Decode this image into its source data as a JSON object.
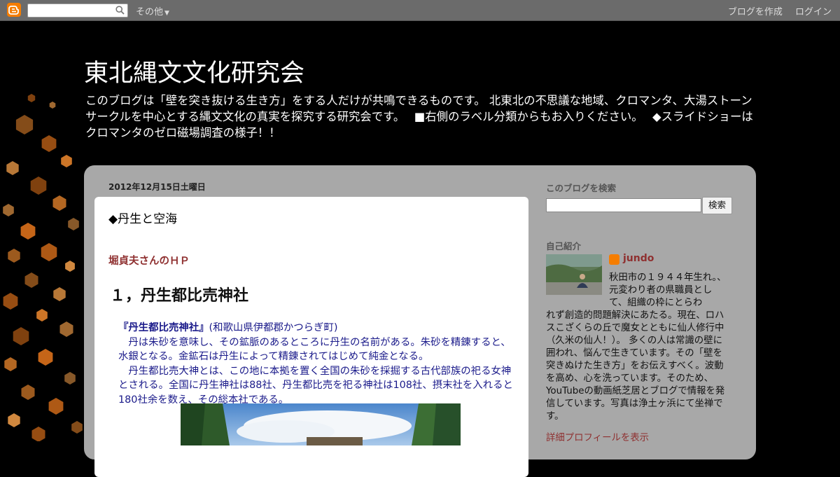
{
  "navbar": {
    "more_label": "その他",
    "create_blog": "ブログを作成",
    "login": "ログイン"
  },
  "blog": {
    "title": "東北縄文文化研究会",
    "description": "このブログは「壁を突き抜ける生き方」をする人だけが共鳴できるものです。 北東北の不思議な地域、クロマンタ、大湯ストーンサークルを中心とする縄文文化の真実を探究する研究会です。　 ■右側のラベル分類からもお入りください。　 ◆スライドショーはクロマンタのゼロ磁場調査の様子！！"
  },
  "post": {
    "date": "2012年12月15日土曜日",
    "title": "◆丹生と空海",
    "link_text": "堀貞夫さんのＨＰ",
    "heading": "１，丹生都比売神社",
    "shrine_name": "『丹生都比売神社』",
    "shrine_location": "(和歌山県伊都郡かつらぎ町)",
    "paragraph1": "　丹は朱砂を意味し、その鉱脈のあるところに丹生の名前がある。朱砂を精錬すると、水銀となる。金鉱石は丹生によって精錬されてはじめて純金となる。",
    "paragraph2": "　丹生都比売大神とは、この地に本拠を置く全国の朱砂を採掘する古代部族の祀る女神とされる。全国に丹生神社は88社、丹生都比売を祀る神社は108社、摂末社を入れると180社余を数え、その総本社である。"
  },
  "sidebar": {
    "search_title": "このブログを検索",
    "search_button": "検索",
    "profile_title": "自己紹介",
    "author_name": "jundo",
    "profile_line1": "秋田市の１９４４年生れ。、元変わり者の県職員として、組織の枠にとらわ",
    "profile_line2": "れず創造的問題解決にあたる。現在、ロハスこざくらの丘で魔女とともに仙人修行中（久米の仙人！）。 多くの人は常識の壁に囲われ、悩んで生きています。その「壁を突きぬけた生き方」をお伝えすべく。波動を高め、心を洗っています。そのため、YouTubeの動画紙芝居とブログで情報を発信しています。写真は浄土ヶ浜にて坐禅です。",
    "profile_link": "詳細プロフィールを表示"
  },
  "colors": {
    "accent_link": "#8f3030",
    "body_text": "#1a1a8a",
    "blogger_orange": "#f57d00"
  }
}
